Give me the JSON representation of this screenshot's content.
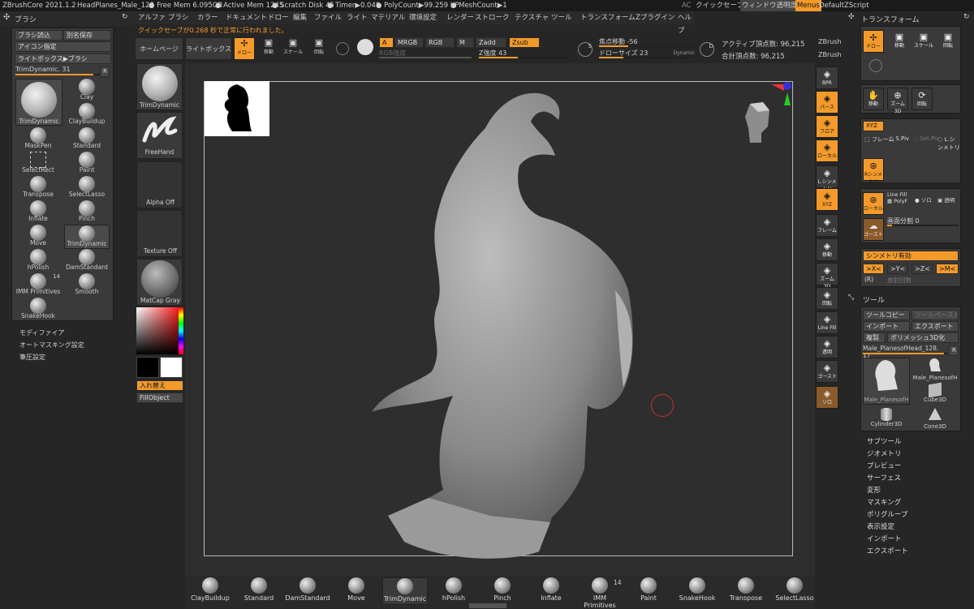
{
  "topbar": {
    "app": "ZBrushCore 2021.1.2",
    "file": "HeadPlanes_Male_128",
    "free_mem": "● Free Mem 6.095GB",
    "active_mem": "● Active Mem 1245",
    "scratch": "● Scratch Disk 45",
    "timer": "● Timer▶0.048",
    "polycount": "● PolyCount▶99.259 KP",
    "meshcount": "● MeshCount▶1",
    "ac": "AC",
    "quicksave": "クイックセーブ",
    "transparency": "ウィンドウ透明度",
    "menus": "Menus",
    "script": "DefaultZScript"
  },
  "menubar": [
    "アルファ",
    "ブラシ",
    "カラー",
    "ドキュメント",
    "ドロー",
    "編集",
    "ファイル",
    "ライト",
    "マテリアル",
    "環境設定",
    "レンダー",
    "ストローク",
    "テクスチャ",
    "ツール",
    "トランスフォーム",
    "Zプラグイン",
    "ヘルプ"
  ],
  "notice": "クイックセーブが0.268 秒で正常に行われました。",
  "left": {
    "title": "ブラシ",
    "buttons": [
      "ブラシ読込",
      "別名保存",
      "アイコン指定",
      "ライトボックス▶ブラシ"
    ],
    "slider": "TrimDynamic. 31",
    "slider_r": "R",
    "main_brush": "TrimDynamic",
    "brushes": [
      "Clay",
      "ClayBuildup",
      "MaskPen",
      "Standard",
      "SelectRect",
      "Paint",
      "Transpose",
      "SelectLasso",
      "Inflate",
      "Pinch",
      "Move",
      "TrimDynamic",
      "hPolish",
      "DamStandard",
      "IMM Primitives",
      "Smooth",
      "SnakeHook"
    ],
    "imm_count": "14",
    "submenus": [
      "モディファイア",
      "オートマスキング設定",
      "筆圧設定"
    ]
  },
  "shelf_left": {
    "home": "ホームページ",
    "lightbox": "ライトボックス",
    "trim": "TrimDynamic",
    "freehand": "FreeHand",
    "alpha": "Alpha Off",
    "texture": "Texture Off",
    "matcap": "MatCap Gray",
    "swap": "入れ替え",
    "fill": "FillObject"
  },
  "toolbar": {
    "draw": "ドロー",
    "move": "移動",
    "scale": "スケール",
    "rotate": "回転",
    "a": "A",
    "mrgb": "MRGB",
    "rgb": "RGB",
    "m": "M",
    "zadd": "Zadd",
    "zsub": "Zsub",
    "rgb_int": "RGB強度",
    "z_int": "Z強度 43",
    "focal": "焦点移動 -56",
    "draw_size": "ドローサイズ 23",
    "dynamic": "Dynamic",
    "s": "S",
    "d": "D",
    "active_pts": "アクティブ頂点数: 96,215",
    "total_pts": "合計頂点数: 96,215",
    "zbrush1": "ZBrush",
    "zbrush2": "ZBrush"
  },
  "right_vtools": [
    "BPR",
    "パース",
    "フロア",
    "ローカル",
    "L.シンメトリ",
    "XYZ",
    "フレーム",
    "移動",
    "ズーム3D",
    "回転",
    "Line Fill",
    "PolyF",
    "透明",
    "ゴースト",
    "ソロ"
  ],
  "transform": {
    "title": "トランスフォーム",
    "draw": "ドロー",
    "move": "移動",
    "scale": "スケール",
    "rotate": "回転",
    "move2": "移動",
    "zoom3d": "ズーム3D",
    "rotate2": "回転",
    "xyz": "XYZ",
    "frame": "フレーム",
    "sp": "S.Piv",
    "sel_piv": "Set.Piv",
    "lsym": "L.シンメトリ",
    "rsym": "Rシンメトリ",
    "local": "ローカル",
    "linefill": "Line Fill",
    "polyf": "PolyF",
    "solo": "ソロ",
    "transp": "透明",
    "ghost": "ゴースト",
    "subdiv": "画面分割 0",
    "sym": "シンメトリ有効",
    "x": ">X<",
    "y": ">Y<",
    "z": ">Z<",
    "m": ">M<",
    "r": "(R)",
    "radial": "放射回数"
  },
  "tool": {
    "title": "ツール",
    "copy": "ツールコピー",
    "paste": "ツールペースト",
    "import": "インポート",
    "export": "エクスポート",
    "dup": "複製",
    "polymesh": "ポリメッシュ3D化",
    "slider": "Male_PlanesofHead_128. 17",
    "r": "R",
    "items": [
      "Male_PlanesofH",
      "Male_PlanesofH",
      "Cube3D",
      "Cylinder3D",
      "Cone3D"
    ],
    "sub": [
      "サブツール",
      "ジオメトリ",
      "プレビュー",
      "サーフェス",
      "変形",
      "マスキング",
      "ポリグループ",
      "表示設定",
      "インポート",
      "エクスポート"
    ]
  },
  "bottom": [
    "ClayBuildup",
    "Standard",
    "DamStandard",
    "Move",
    "TrimDynamic",
    "hPolish",
    "Pinch",
    "Inflate",
    "IMM Primitives",
    "Paint",
    "SnakeHook",
    "Transpose",
    "SelectLasso"
  ],
  "bottom_count": "14"
}
